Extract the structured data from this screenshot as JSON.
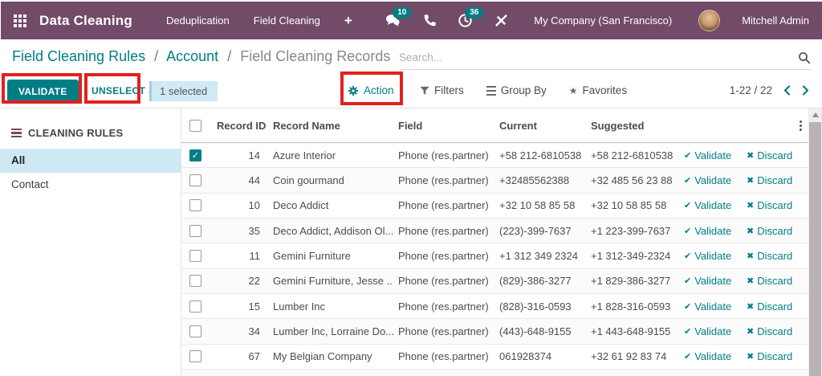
{
  "navbar": {
    "app_name": "Data Cleaning",
    "menus": [
      "Deduplication",
      "Field Cleaning"
    ],
    "plus": "+",
    "badges": {
      "messages": "10",
      "activities": "36"
    },
    "company": "My Company (San Francisco)",
    "user": "Mitchell Admin"
  },
  "breadcrumb": {
    "links": [
      "Field Cleaning Rules",
      "Account"
    ],
    "current": "Field Cleaning Records",
    "separator": "/"
  },
  "search": {
    "placeholder": "Search..."
  },
  "control_panel": {
    "validate_label": "VALIDATE",
    "unselect_label": "UNSELECT",
    "selected_badge": "1 selected",
    "action_label": "Action",
    "filters_label": "Filters",
    "group_by_label": "Group By",
    "favorites_label": "Favorites",
    "pager": "1-22 / 22"
  },
  "sidebar": {
    "title": "CLEANING RULES",
    "items": [
      {
        "label": "All",
        "active": true
      },
      {
        "label": "Contact",
        "active": false
      }
    ]
  },
  "table": {
    "columns": [
      "Record ID",
      "Record Name",
      "Field",
      "Current",
      "Suggested"
    ],
    "row_actions": {
      "validate": "Validate",
      "discard": "Discard"
    },
    "rows": [
      {
        "checked": true,
        "id": "14",
        "name": "Azure Interior",
        "field": "Phone (res.partner)",
        "current": "+58 212-6810538",
        "suggested": "+58 212-6810538"
      },
      {
        "checked": false,
        "id": "44",
        "name": "Coin gourmand",
        "field": "Phone (res.partner)",
        "current": "+32485562388",
        "suggested": "+32 485 56 23 88"
      },
      {
        "checked": false,
        "id": "10",
        "name": "Deco Addict",
        "field": "Phone (res.partner)",
        "current": "+32 10 58 85 58",
        "suggested": "+32 10 58 85 58"
      },
      {
        "checked": false,
        "id": "35",
        "name": "Deco Addict, Addison Ol...",
        "field": "Phone (res.partner)",
        "current": "(223)-399-7637",
        "suggested": "+1 223-399-7637"
      },
      {
        "checked": false,
        "id": "11",
        "name": "Gemini Furniture",
        "field": "Phone (res.partner)",
        "current": "+1 312 349 2324",
        "suggested": "+1 312-349-2324"
      },
      {
        "checked": false,
        "id": "22",
        "name": "Gemini Furniture, Jesse ...",
        "field": "Phone (res.partner)",
        "current": "(829)-386-3277",
        "suggested": "+1 829-386-3277"
      },
      {
        "checked": false,
        "id": "15",
        "name": "Lumber Inc",
        "field": "Phone (res.partner)",
        "current": "(828)-316-0593",
        "suggested": "+1 828-316-0593"
      },
      {
        "checked": false,
        "id": "34",
        "name": "Lumber Inc, Lorraine Do...",
        "field": "Phone (res.partner)",
        "current": "(443)-648-9155",
        "suggested": "+1 443-648-9155"
      },
      {
        "checked": false,
        "id": "67",
        "name": "My Belgian Company",
        "field": "Phone (res.partner)",
        "current": "061928374",
        "suggested": "+32 61 92 83 74"
      }
    ]
  },
  "colors": {
    "accent": "#017e84",
    "navbar_bg": "#714B67",
    "annotation": "#e3201d",
    "sidebar_active_bg": "#cfe9f4"
  }
}
